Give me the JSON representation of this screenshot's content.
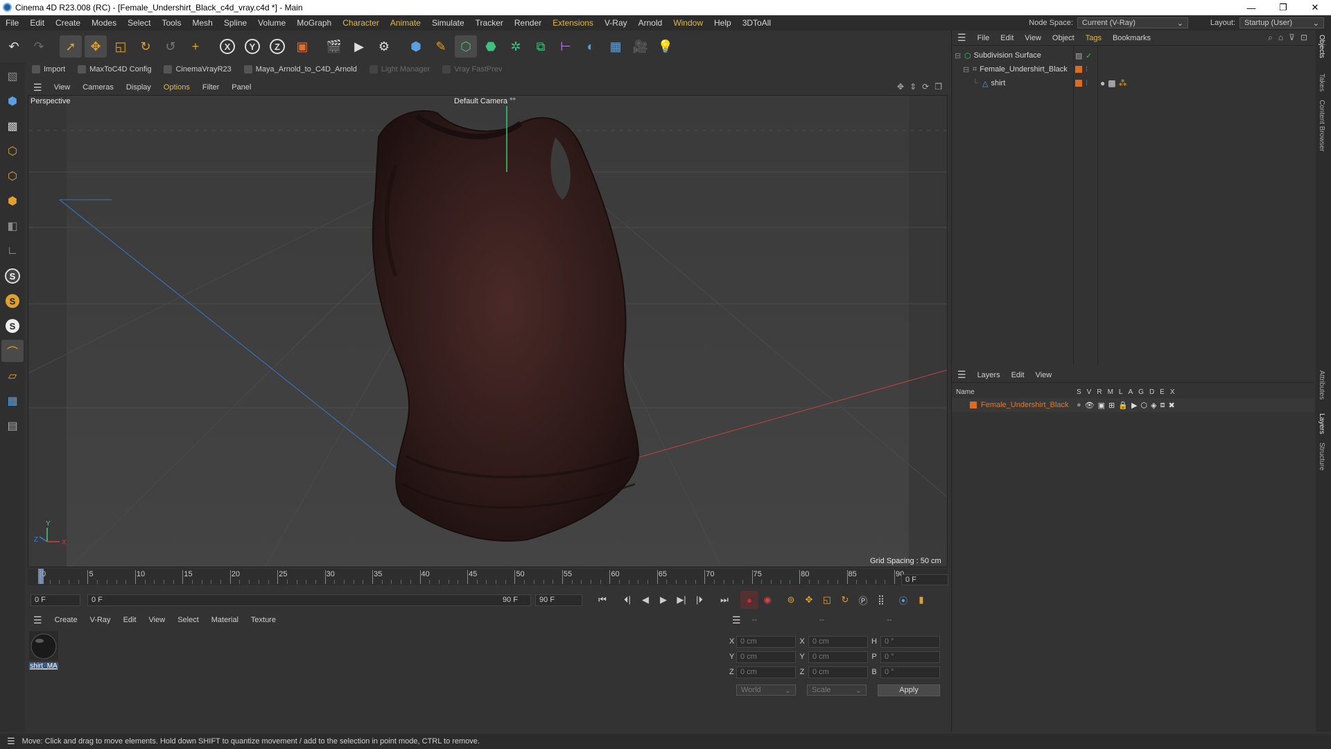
{
  "window": {
    "title": "Cinema 4D R23.008 (RC) - [Female_Undershirt_Black_c4d_vray.c4d *] - Main",
    "controls": [
      "—",
      "❐",
      "✕"
    ]
  },
  "menu": {
    "items": [
      "File",
      "Edit",
      "Create",
      "Modes",
      "Select",
      "Tools",
      "Mesh",
      "Spline",
      "Volume",
      "MoGraph",
      "Character",
      "Animate",
      "Simulate",
      "Tracker",
      "Render",
      "Extensions",
      "V-Ray",
      "Arnold",
      "Window",
      "Help",
      "3DToAll"
    ],
    "node_space_label": "Node Space:",
    "node_space_value": "Current (V-Ray)",
    "layout_label": "Layout:",
    "layout_value": "Startup (User)"
  },
  "plugins": [
    {
      "label": "Import",
      "enabled": true
    },
    {
      "label": "MaxToC4D Config",
      "enabled": true
    },
    {
      "label": "CinemaVrayR23",
      "enabled": true
    },
    {
      "label": "Maya_Arnold_to_C4D_Arnold",
      "enabled": true
    },
    {
      "label": "Light Manager",
      "enabled": false
    },
    {
      "label": "Vray FastPrev",
      "enabled": false
    }
  ],
  "viewport": {
    "menu": [
      "View",
      "Cameras",
      "Display",
      "Options",
      "Filter",
      "Panel"
    ],
    "label": "Perspective",
    "camera": "Default Camera",
    "camera_icon": "°°",
    "grid_spacing": "Grid Spacing : 50 cm",
    "axis": {
      "x": "X",
      "y": "Y",
      "z": "Z"
    }
  },
  "timeline": {
    "ticks": [
      "0",
      "5",
      "10",
      "15",
      "20",
      "25",
      "30",
      "35",
      "40",
      "45",
      "50",
      "55",
      "60",
      "65",
      "70",
      "75",
      "80",
      "85",
      "90"
    ],
    "current_frame": "0 F"
  },
  "playback": {
    "start": "0 F",
    "range_start": "0 F",
    "range_end": "90 F",
    "end": "90 F"
  },
  "material": {
    "menu": [
      "Create",
      "V-Ray",
      "Edit",
      "View",
      "Select",
      "Material",
      "Texture"
    ],
    "items": [
      {
        "name": "shirt_MA"
      }
    ]
  },
  "coords": {
    "header": [
      "--",
      "--",
      "--"
    ],
    "rows": [
      {
        "a_label": "X",
        "a_val": "0 cm",
        "b_label": "X",
        "b_val": "0 cm",
        "c_label": "H",
        "c_val": "0 °"
      },
      {
        "a_label": "Y",
        "a_val": "0 cm",
        "b_label": "Y",
        "b_val": "0 cm",
        "c_label": "P",
        "c_val": "0 °"
      },
      {
        "a_label": "Z",
        "a_val": "0 cm",
        "b_label": "Z",
        "b_val": "0 cm",
        "c_label": "B",
        "c_val": "0 °"
      }
    ],
    "world": "World",
    "scale": "Scale",
    "apply": "Apply"
  },
  "objects": {
    "menu": [
      "File",
      "Edit",
      "View",
      "Object",
      "Tags",
      "Bookmarks"
    ],
    "tree": [
      "Subdivision Surface",
      "Female_Undershirt_Black",
      "shirt"
    ]
  },
  "layers": {
    "menu": [
      "Layers",
      "Edit",
      "View"
    ],
    "columns": [
      "Name",
      "S",
      "V",
      "R",
      "M",
      "L",
      "A",
      "G",
      "D",
      "E",
      "X"
    ],
    "rows": [
      {
        "name": "Female_Undershirt_Black"
      }
    ]
  },
  "side_tabs": [
    "Objects",
    "Takes",
    "Content Browser",
    "Attributes",
    "Layers",
    "Structure"
  ],
  "status": "Move: Click and drag to move elements. Hold down SHIFT to quantize movement / add to the selection in point mode, CTRL to remove."
}
